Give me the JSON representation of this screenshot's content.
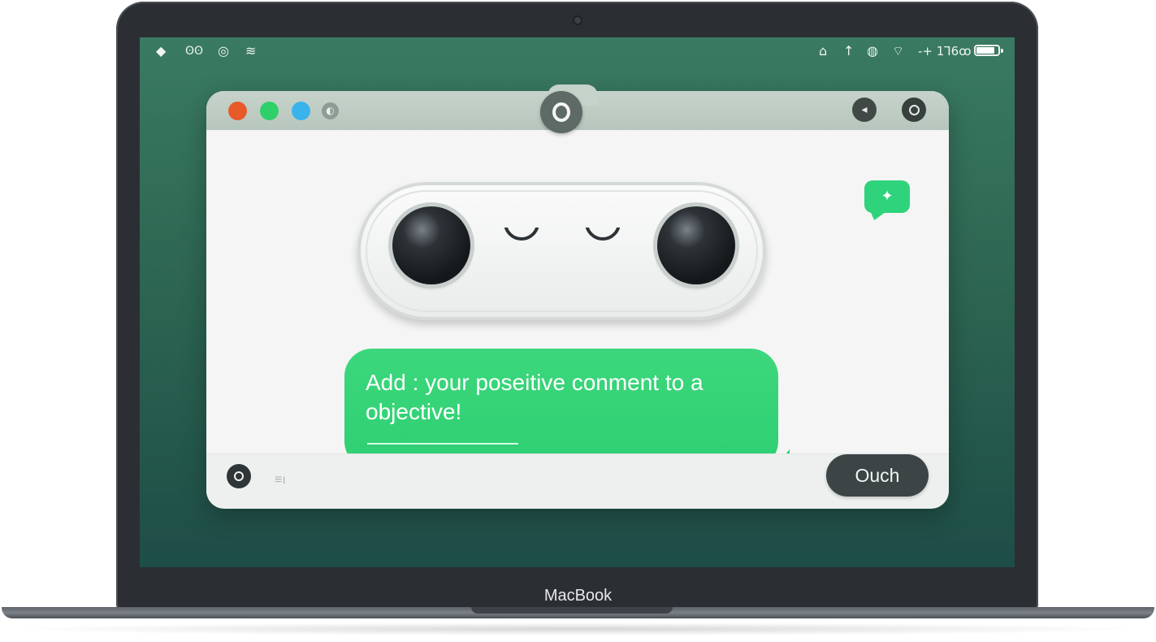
{
  "device": {
    "brand_label": "MacBook"
  },
  "menubar": {
    "left_icons": [
      "diamond-icon",
      "eyes-icon",
      "focus-icon",
      "wifi-icon"
    ],
    "right_icons": [
      "home-icon",
      "upload-icon",
      "mic-icon",
      "wifi-status-icon"
    ],
    "time": "-+ 1Ꞁ6ꝏ",
    "battery_level": 0.9
  },
  "window": {
    "traffic_lights": [
      "close",
      "maximize",
      "minimize",
      "extra"
    ],
    "toolbar_icons": [
      "volume-icon",
      "record-icon"
    ]
  },
  "chat": {
    "badge_icon": "sparkle-icon",
    "badge_glyph": "✦",
    "message": "Add : your poseitive conment to a objective!",
    "input_placeholder": "≡ı",
    "send_label": "Ouch"
  },
  "colors": {
    "accent_green": "#2fcf72",
    "desktop_green": "#2d6652",
    "button_dark": "#3c4446"
  }
}
